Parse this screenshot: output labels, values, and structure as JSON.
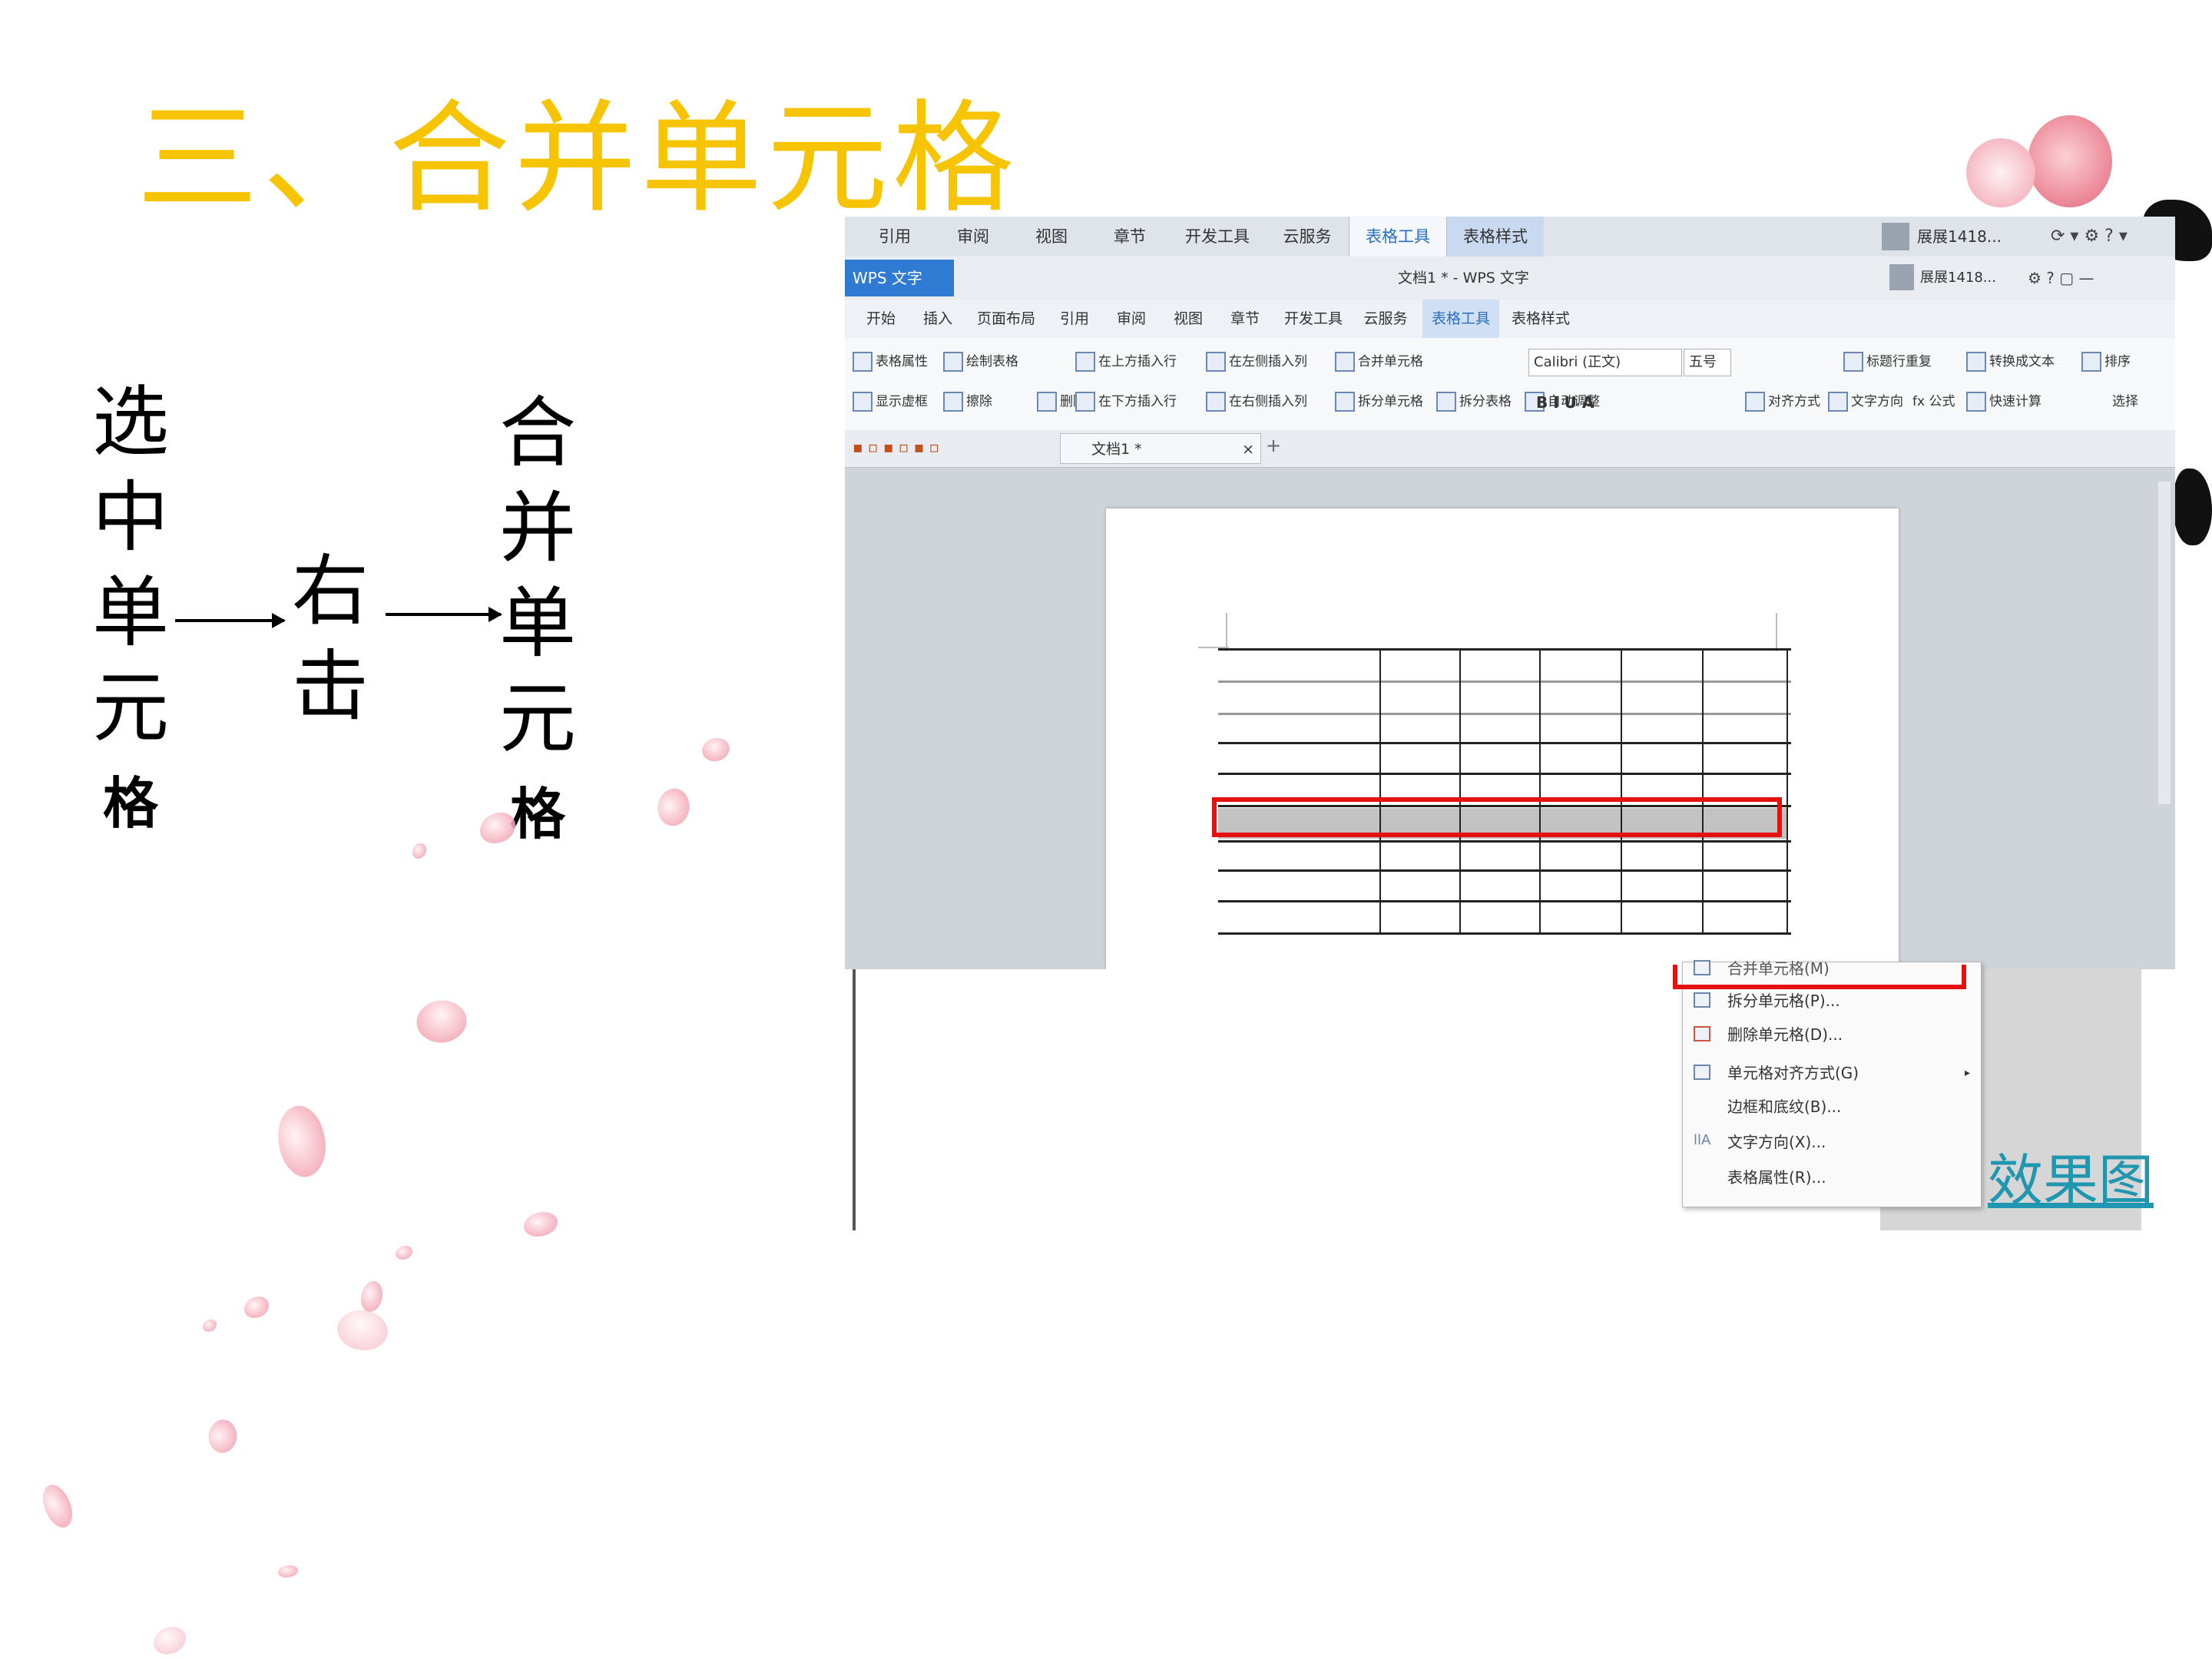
{
  "slide": {
    "title": "三、合并单元格",
    "step1": [
      "选",
      "中",
      "单",
      "元",
      "格"
    ],
    "step2": [
      "右",
      "击"
    ],
    "step3": [
      "合",
      "并",
      "单",
      "元",
      "格"
    ],
    "link_text": "效果图"
  },
  "screenshot": {
    "top_tabs": [
      "引用",
      "审阅",
      "视图",
      "章节",
      "开发工具",
      "云服务",
      "表格工具",
      "表格样式"
    ],
    "user_label": "展展1418...",
    "app_button": "WPS 文字",
    "window_title": "文档1 * - WPS 文字",
    "ribbon_tabs": [
      "开始",
      "插入",
      "页面布局",
      "引用",
      "审阅",
      "视图",
      "章节",
      "开发工具",
      "云服务",
      "表格工具",
      "表格样式"
    ],
    "ribbon_buttons": [
      "表格属性",
      "显示虚框",
      "绘制表格",
      "擦除",
      "删除",
      "在上方插入行",
      "在下方插入行",
      "在左侧插入列",
      "在右侧插入列",
      "合并单元格",
      "拆分单元格",
      "拆分表格",
      "自动调整",
      "对齐方式",
      "文字方向",
      "fx 公式",
      "快速计算",
      "标题行重复",
      "转换成文本",
      "排序",
      "选择"
    ],
    "font_name": "Calibri (正文)",
    "font_size": "五号",
    "doc_tab": "文档1 *",
    "context_menu": [
      {
        "label": "合并单元格(M)",
        "icon": "merge-cells-icon"
      },
      {
        "label": "拆分单元格(P)...",
        "icon": "split-cells-icon"
      },
      {
        "label": "删除单元格(D)...",
        "icon": "delete-cells-icon"
      },
      {
        "label": "单元格对齐方式(G)",
        "icon": "cell-align-icon",
        "submenu": true
      },
      {
        "label": "边框和底纹(B)...",
        "icon": ""
      },
      {
        "label": "文字方向(X)...",
        "icon": "text-direction-icon"
      },
      {
        "label": "表格属性(R)...",
        "icon": ""
      }
    ],
    "colors": {
      "highlight": "#e51010",
      "selection": "#c2c2c2",
      "accent": "#2f7ad2"
    }
  }
}
